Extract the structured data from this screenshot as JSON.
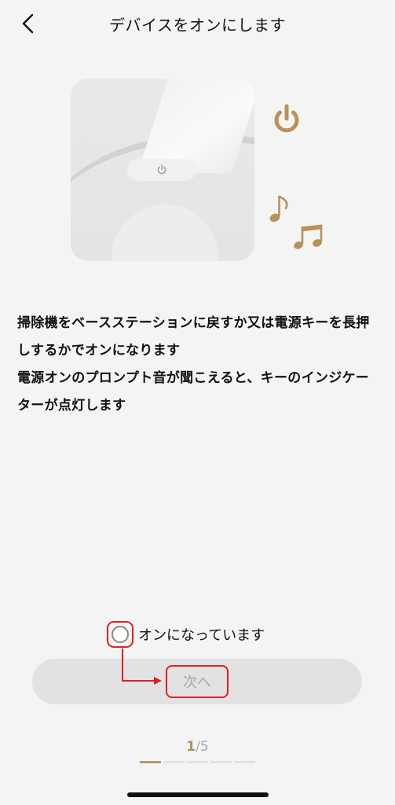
{
  "header": {
    "title": "デバイスをオンにします",
    "back_icon": "chevron-left-icon"
  },
  "illustration": {
    "device_button_icon": "power-icon",
    "accent_icon": "power-icon",
    "note_icons": [
      "music-note-icon",
      "double-music-note-icon"
    ],
    "accent_color": "#b8925a"
  },
  "description": {
    "line1": "掃除機をベースステーションに戻すか又は電源キーを長押しするかでオンになります",
    "line2": "電源オンのプロンプト音が聞こえると、キーのインジケーターが点灯します"
  },
  "confirm": {
    "label": "オンになっています",
    "checked": false
  },
  "next_button": {
    "label": "次へ",
    "enabled": false
  },
  "pager": {
    "current": "1",
    "separator": "/",
    "total": "5",
    "progress_steps": 5,
    "progress_active": 1
  },
  "colors": {
    "highlight": "#e02020",
    "accent": "#b8925a",
    "background": "#f4f4f4"
  }
}
